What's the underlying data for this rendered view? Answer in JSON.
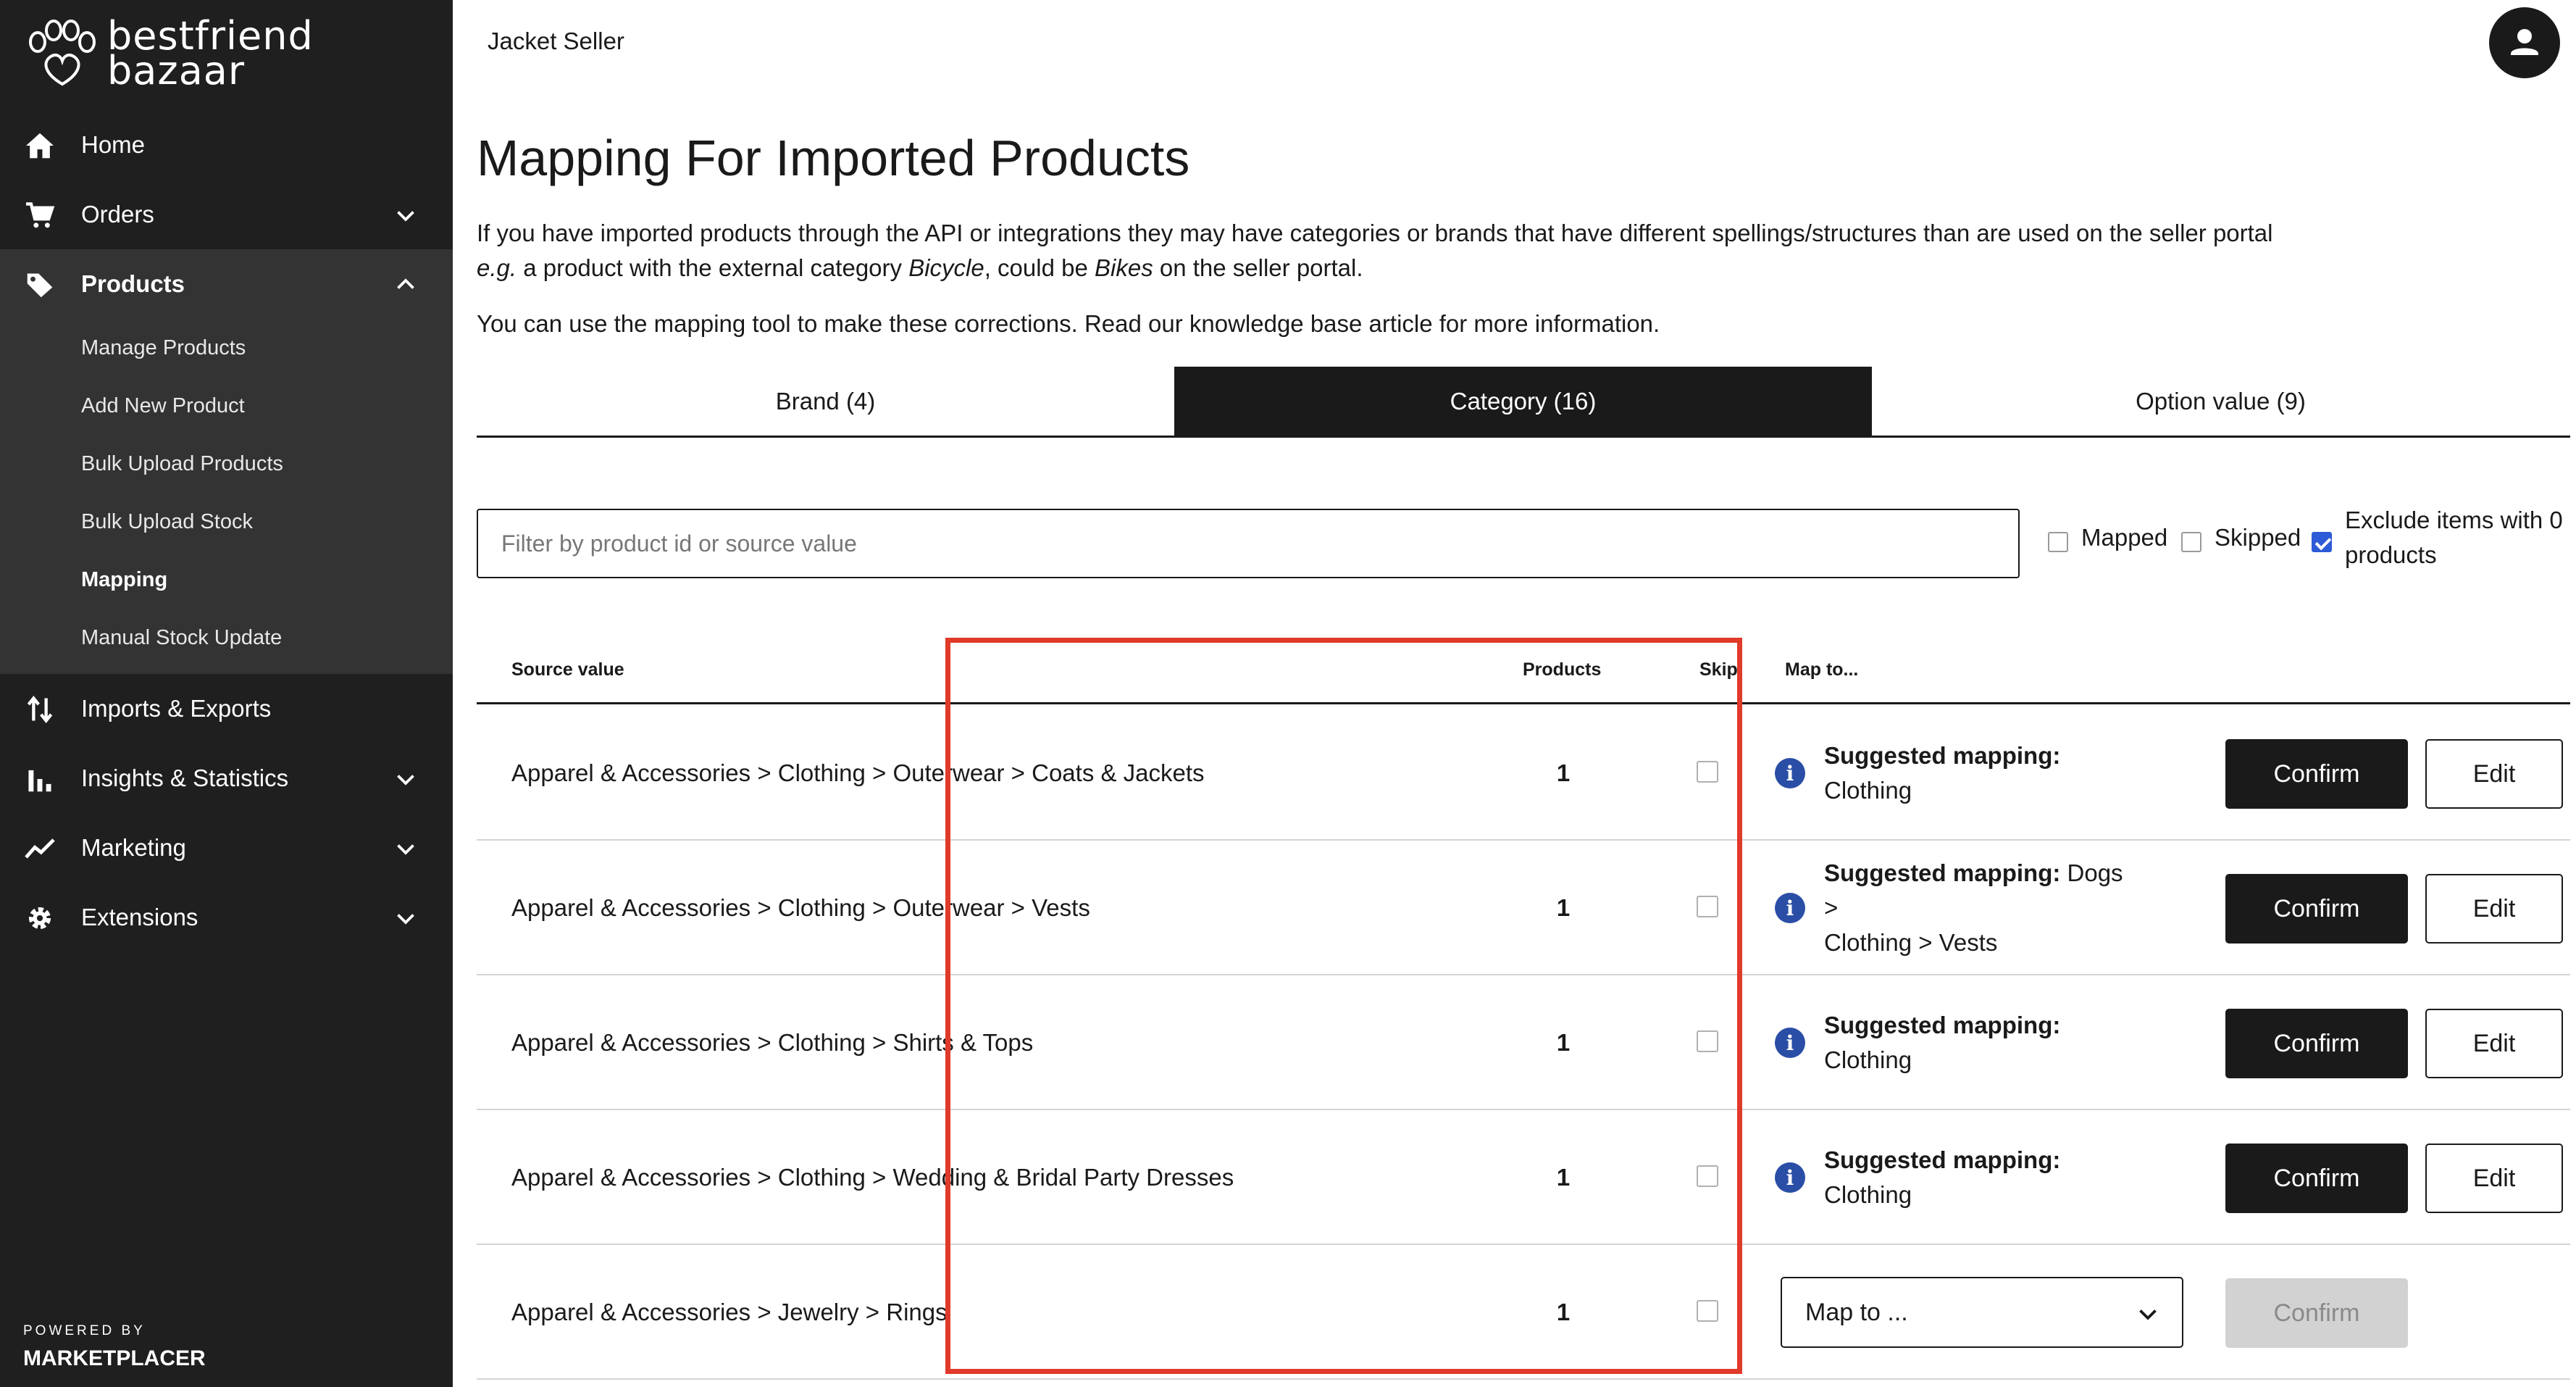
{
  "brand": {
    "name_line1": "bestfriend",
    "name_line2": "bazaar",
    "powered_by": "POWERED BY",
    "platform": "MARKETPLACER"
  },
  "nav": {
    "items": [
      {
        "label": "Home",
        "icon": "home-icon"
      },
      {
        "label": "Orders",
        "icon": "cart-icon"
      },
      {
        "label": "Products",
        "icon": "tag-icon"
      }
    ],
    "products_sub": [
      "Manage Products",
      "Add New Product",
      "Bulk Upload Products",
      "Bulk Upload Stock",
      "Mapping",
      "Manual Stock Update"
    ],
    "lower": [
      {
        "label": "Imports & Exports",
        "icon": "import-export-icon"
      },
      {
        "label": "Insights & Statistics",
        "icon": "bar-chart-icon"
      },
      {
        "label": "Marketing",
        "icon": "trend-line-icon"
      },
      {
        "label": "Extensions",
        "icon": "gear-icon"
      }
    ]
  },
  "header": {
    "store_name": "Jacket Seller"
  },
  "page": {
    "title": "Mapping For Imported Products",
    "intro_line1": "If you have imported products through the API or integrations they may have categories or brands that have different spellings/structures than are used on the seller portal",
    "intro_eg": "e.g.",
    "intro_a": " a product with the external category ",
    "intro_bicycle": "Bicycle",
    "intro_b": ", could be ",
    "intro_bikes": "Bikes",
    "intro_c": " on the seller portal.",
    "intro_line2": "You can use the mapping tool to make these corrections. Read our knowledge base article for more information."
  },
  "tabs": [
    "Brand (4)",
    "Category (16)",
    "Option value (9)"
  ],
  "filter": {
    "placeholder": "Filter by product id or source value",
    "mapped": "Mapped",
    "skipped": "Skipped",
    "exclude_line1": "Exclude items with 0",
    "exclude_line2": "products"
  },
  "table": {
    "headers": {
      "source": "Source value",
      "products": "Products",
      "skip": "Skip",
      "map_to": "Map to..."
    },
    "suggested_label": "Suggested mapping:",
    "confirm": "Confirm",
    "edit": "Edit",
    "map_placeholder": "Map to ...",
    "rows": [
      {
        "source": "Apparel & Accessories > Clothing > Outerwear > Coats & Jackets",
        "products": "1",
        "suggestion_line1": " Clothing",
        "suggestion_line2": ""
      },
      {
        "source": "Apparel & Accessories > Clothing > Outerwear > Vests",
        "products": "1",
        "suggestion_line1": " Dogs >",
        "suggestion_line2": "Clothing > Vests"
      },
      {
        "source": "Apparel & Accessories > Clothing > Shirts & Tops",
        "products": "1",
        "suggestion_line1": " Clothing",
        "suggestion_line2": ""
      },
      {
        "source": "Apparel & Accessories > Clothing > Wedding & Bridal Party Dresses",
        "products": "1",
        "suggestion_line1": " Clothing",
        "suggestion_line2": ""
      },
      {
        "source": "Apparel & Accessories > Jewelry > Rings",
        "products": "1"
      }
    ]
  },
  "colors": {
    "sidebar": "#1f1f1f",
    "sidebar_active": "#333333",
    "highlight": "#e03a2a",
    "info": "#2a4ea6",
    "checkbox": "#2d5bd7"
  }
}
